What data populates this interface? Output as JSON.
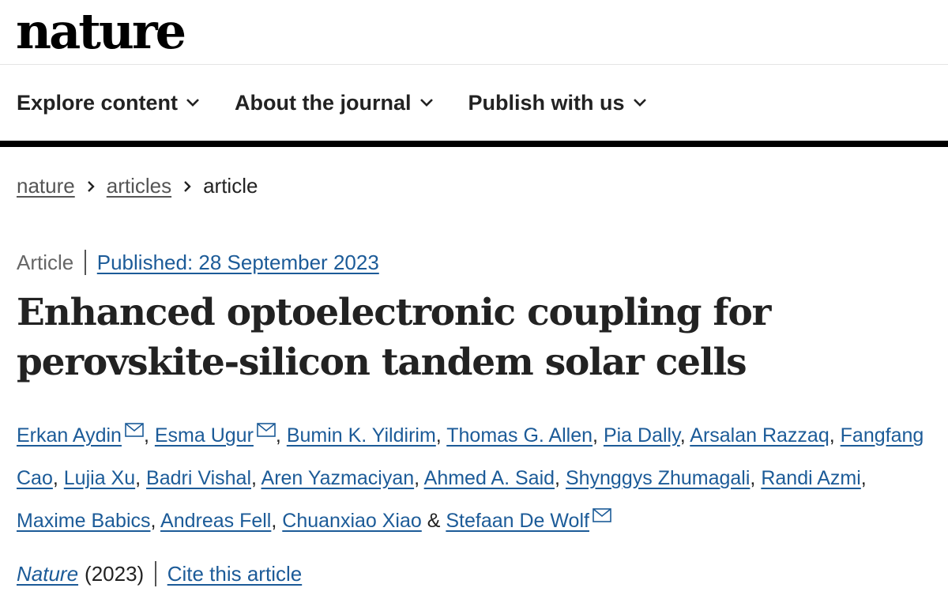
{
  "logo": "nature",
  "nav": {
    "items": [
      {
        "label": "Explore content"
      },
      {
        "label": "About the journal"
      },
      {
        "label": "Publish with us"
      }
    ]
  },
  "breadcrumb": {
    "items": [
      "nature",
      "articles"
    ],
    "current": "article"
  },
  "article": {
    "type": "Article",
    "published": "Published: 28 September 2023",
    "title": "Enhanced optoelectronic coupling for perovskite-silicon tandem solar cells",
    "authors": [
      {
        "name": "Erkan Aydin",
        "sep": ", "
      },
      {
        "name": "Esma Ugur",
        "sep": ", "
      },
      {
        "name": "Bumin K. Yildirim",
        "sep": ", "
      },
      {
        "name": "Thomas G. Allen",
        "sep": ", "
      },
      {
        "name": "Pia Dally",
        "sep": ", "
      },
      {
        "name": "Arsalan Razzaq",
        "sep": ", "
      },
      {
        "name": "Fangfang Cao",
        "sep": ", "
      },
      {
        "name": "Lujia Xu",
        "sep": ", "
      },
      {
        "name": "Badri Vishal",
        "sep": ", "
      },
      {
        "name": "Aren Yazmaciyan",
        "sep": ", "
      },
      {
        "name": "Ahmed A. Said",
        "sep": ", "
      },
      {
        "name": "Shynggys Zhumagali",
        "sep": ", "
      },
      {
        "name": "Randi Azmi",
        "sep": ", "
      },
      {
        "name": "Maxime Babics",
        "sep": ", "
      },
      {
        "name": "Andreas Fell",
        "sep": ", "
      },
      {
        "name": "Chuanxiao Xiao",
        "sep": " & "
      },
      {
        "name": "Stefaan De Wolf",
        "sep": ""
      }
    ],
    "journal": "Nature",
    "year": "(2023)",
    "cite": "Cite this article"
  },
  "colors": {
    "link": "#1c5b98",
    "text": "#222222",
    "rule": "#000000"
  }
}
